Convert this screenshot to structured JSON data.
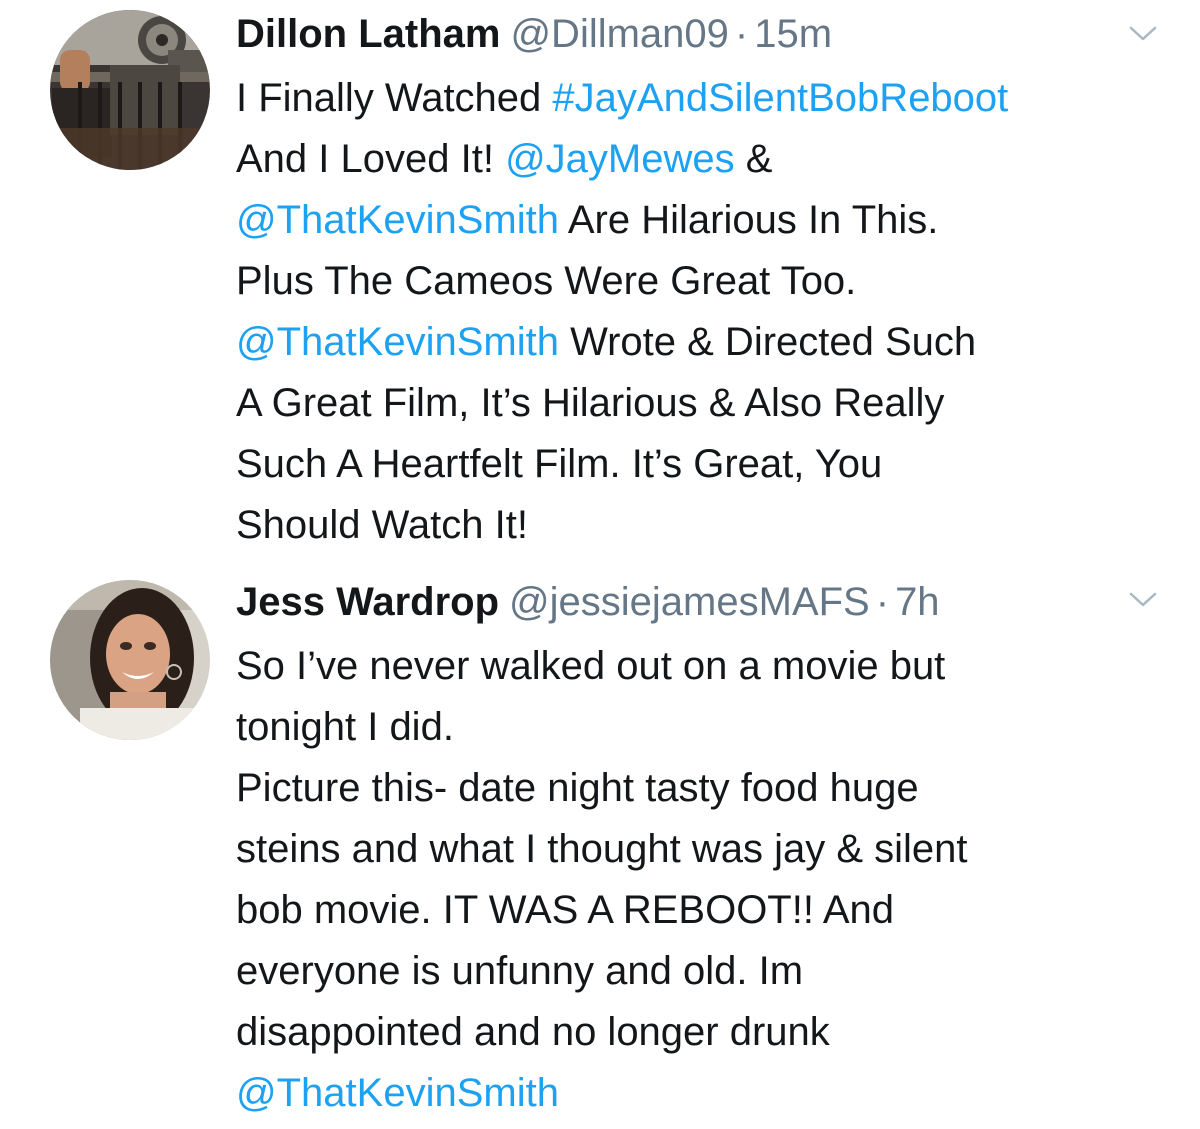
{
  "colors": {
    "link": "#1da1f2",
    "secondary_text": "#657786",
    "primary_text": "#14171a",
    "background": "#ffffff"
  },
  "tweets": [
    {
      "display_name": "Dillon Latham",
      "handle": "@Dillman09",
      "separator": "·",
      "time": "15m",
      "menu_icon": "chevron-down-icon",
      "lines": [
        [
          {
            "t": "I Finally Watched "
          },
          {
            "t": "#JayAndSilentBobReboot",
            "link": true
          }
        ],
        [
          {
            "t": "And I Loved It! "
          },
          {
            "t": "@JayMewes",
            "link": true
          },
          {
            "t": " &"
          }
        ],
        [
          {
            "t": "@ThatKevinSmith",
            "link": true
          },
          {
            "t": " Are Hilarious In This."
          }
        ],
        [
          {
            "t": "Plus The Cameos Were Great Too."
          }
        ],
        [
          {
            "t": "@ThatKevinSmith",
            "link": true
          },
          {
            "t": " Wrote & Directed Such"
          }
        ],
        [
          {
            "t": "A Great Film, It’s Hilarious & Also Really"
          }
        ],
        [
          {
            "t": "Such A Heartfelt Film. It’s Great, You"
          }
        ],
        [
          {
            "t": "Should Watch It!"
          }
        ]
      ]
    },
    {
      "display_name": "Jess Wardrop",
      "handle": "@jessiejamesMAFS",
      "separator": "·",
      "time": "7h",
      "menu_icon": "chevron-down-icon",
      "lines": [
        [
          {
            "t": "So I’ve never walked out on a movie but"
          }
        ],
        [
          {
            "t": "tonight I did."
          }
        ],
        [
          {
            "t": "Picture this- date night tasty food huge"
          }
        ],
        [
          {
            "t": "steins and what I thought was jay & silent"
          }
        ],
        [
          {
            "t": "bob movie. IT WAS A REBOOT!! And"
          }
        ],
        [
          {
            "t": "everyone is unfunny and old. Im"
          }
        ],
        [
          {
            "t": "disappointed and no longer drunk"
          }
        ],
        [
          {
            "t": "@ThatKevinSmith",
            "link": true
          }
        ]
      ]
    }
  ]
}
